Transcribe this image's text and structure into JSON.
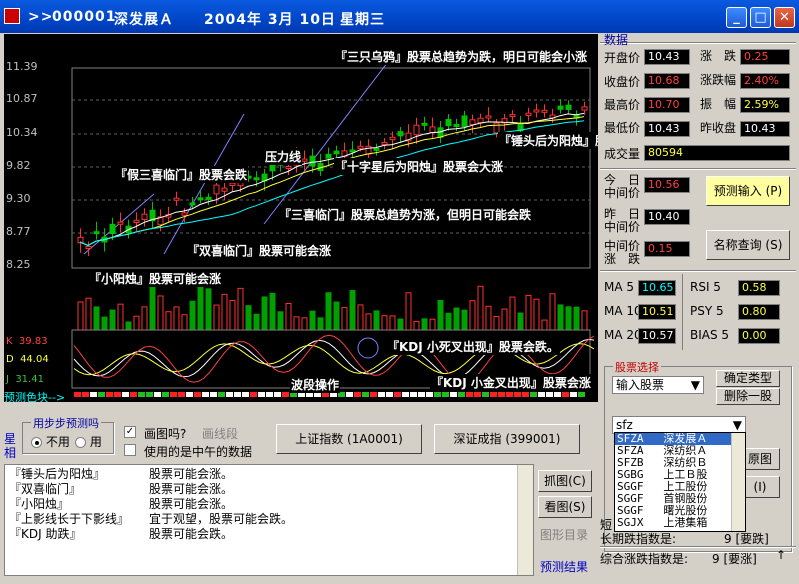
{
  "title": {
    "prefix": ">>",
    "code": "000001",
    "name": "深发展Ａ",
    "date": "2004年 3月 10日",
    "weekday": "星期三"
  },
  "chart": {
    "y_labels": [
      "11.39",
      "10.87",
      "10.34",
      "9.82",
      "9.30",
      "8.77",
      "8.25"
    ],
    "annotations": [
      "『三只乌鸦』股票总趋势为跌，明日可能会小涨",
      "『锤头后为阳烛』股票可能会涨",
      "压力线",
      "『十字星后为阳烛』股票会大涨",
      "『假三喜临门』股票会跌",
      "『三喜临门』股票总趋势为涨，但明日可能会跌",
      "『双喜临门』股票可能会涨",
      "『小阳烛』股票可能会涨",
      "『KDJ 小死叉出现』股票会跌。",
      "波段操作",
      "『KDJ 小金叉出现』股票会涨"
    ],
    "kdj": {
      "k_label": "K",
      "k": "39.83",
      "d_label": "D",
      "d": "44.04",
      "j_label": "J",
      "j": "31.41"
    },
    "color_block_label": "预测色块-->"
  },
  "controls": {
    "step_group_title": "用步步预测吗",
    "radio_no": "不用",
    "radio_yes": "用",
    "chk_chart": "画图吗?",
    "draw_line": "画线段",
    "chk_noon": "使用的是中午的数据",
    "btn_sh": "上证指数 (1A0001)",
    "btn_sz": "深证成指 (399001)",
    "side_label": "星相"
  },
  "text_rows": [
    {
      "pattern": "『锤头后为阳烛』",
      "result": "股票可能会涨。"
    },
    {
      "pattern": "『双喜临门』",
      "result": "股票可能会涨。"
    },
    {
      "pattern": "『小阳烛』",
      "result": "股票可能会涨。"
    },
    {
      "pattern": "『上影线长于下影线』",
      "result": "宜于观望，股票可能会跌。"
    },
    {
      "pattern": "『KDJ 助跌』",
      "result": "股票可能会跌。"
    }
  ],
  "side_buttons": {
    "grab": "抓图(C)",
    "view": "看图(S)",
    "catalog": "图形目录",
    "result": "预测结果"
  },
  "data_panel": {
    "title": "数据",
    "open_label": "开盘价",
    "open": "10.43",
    "change_label": "涨　跌",
    "change": "0.25",
    "close_label": "收盘价",
    "close": "10.68",
    "pct_label": "涨跌幅",
    "pct": "2.40%",
    "high_label": "最高价",
    "high": "10.70",
    "amp_label": "振　幅",
    "amp": "2.59%",
    "low_label": "最低价",
    "low": "10.43",
    "prev_label": "昨收盘",
    "prev": "10.43",
    "vol_label": "成交量",
    "vol": "80594",
    "today_label": "今　日\n中间价",
    "today": "10.56",
    "yest_label": "昨　日\n中间价",
    "yest": "10.40",
    "mid_chg_label": "中间价\n涨　跌",
    "mid_chg": "0.15",
    "predict_btn": "预测输入 (P)",
    "lookup_btn": "名称查询 (S)"
  },
  "indicators": {
    "ma5_label": "MA 5",
    "ma5": "10.65",
    "ma10_label": "MA 10",
    "ma10": "10.51",
    "ma20_label": "MA 20",
    "ma20": "10.57",
    "rsi_label": "RSI  5",
    "rsi": "0.58",
    "psy_label": "PSY  5",
    "psy": "0.80",
    "bias_label": "BIAS 5",
    "bias": "0.00"
  },
  "stock_select": {
    "title": "股票选择",
    "select_value": "输入股票",
    "btn_type": "确定类型",
    "btn_del": "删除一股",
    "input_value": "sfz",
    "btn_draw_short": "原图",
    "btn_l": "(I)",
    "options": [
      {
        "code": "SFZA",
        "name": "深发展Ａ"
      },
      {
        "code": "SFZA",
        "name": "深纺织Ａ"
      },
      {
        "code": "SFZB",
        "name": "深纺织Ｂ"
      },
      {
        "code": "SGBG",
        "name": "上工Ｂ股"
      },
      {
        "code": "SGGF",
        "name": "上工股份"
      },
      {
        "code": "SGGF",
        "name": "首钢股份"
      },
      {
        "code": "SGGF",
        "name": "曙光股份"
      },
      {
        "code": "SGJX",
        "name": "上港集箱"
      }
    ]
  },
  "bottom": {
    "short_label": "短",
    "long_label": "长期跌指数是:",
    "long_value": "9 [要跌]",
    "combined_label": "综合涨跌指数是:",
    "combined_value": "9 [要涨]"
  }
}
